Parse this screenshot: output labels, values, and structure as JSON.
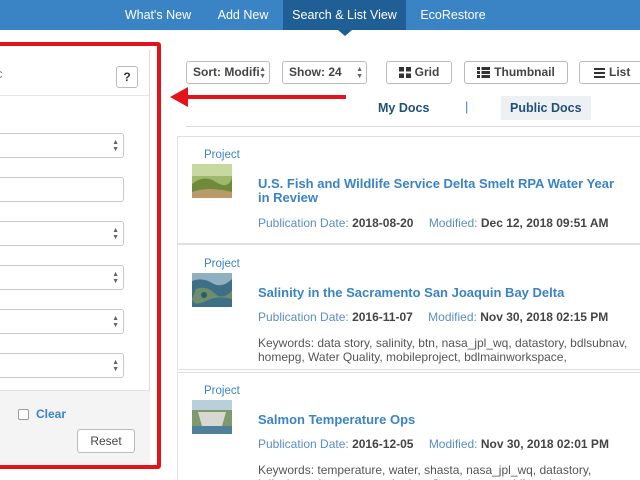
{
  "nav": {
    "items": [
      "What's New",
      "Add New",
      "Search & List View",
      "EcoRestore"
    ],
    "active_index": 2
  },
  "filter_panel": {
    "header_text": "c",
    "help_label": "?",
    "clear_label": "Clear",
    "reset_label": "Reset"
  },
  "toolbar": {
    "sort_value": "Sort: Modifi",
    "show_value": "Show: 24",
    "grid_label": "Grid",
    "thumbnail_label": "Thumbnail",
    "list_label": "List"
  },
  "tabs": {
    "my_docs": "My Docs",
    "separator": "|",
    "public_docs": "Public Docs"
  },
  "labels": {
    "publication_date": "Publication Date:",
    "modified": "Modified:"
  },
  "results": [
    {
      "type": "Project",
      "title": "U.S. Fish and Wildlife Service Delta Smelt RPA Water Year in Review",
      "publication_date": "2018-08-20",
      "modified": "Dec 12, 2018 09:51 AM",
      "keywords": ""
    },
    {
      "type": "Project",
      "title": "Salinity in the Sacramento San Joaquin Bay Delta",
      "publication_date": "2016-11-07",
      "modified": "Nov 30, 2018 02:15 PM",
      "keywords": "Keywords: data story, salinity, btn, nasa_jpl_wq, datastory, bdlsubnav, homepg, Water Quality, mobileproject, bdlmainworkspace,"
    },
    {
      "type": "Project",
      "title": "Salmon Temperature Ops",
      "publication_date": "2016-12-05",
      "modified": "Nov 30, 2018 02:01 PM",
      "keywords": "Keywords: temperature, water, shasta, nasa_jpl_wq, datastory, bdlsubnav, homepg, monitoring, Operations, mobileproject,"
    }
  ],
  "colors": {
    "nav_bg": "#3a84c5",
    "nav_active": "#1f5f95",
    "link": "#3a84c5",
    "annotation_red": "#e3131b"
  },
  "icons": [
    "help-icon",
    "grid-icon",
    "thumbnail-list-icon",
    "list-icon",
    "arrow-left-annotation"
  ]
}
